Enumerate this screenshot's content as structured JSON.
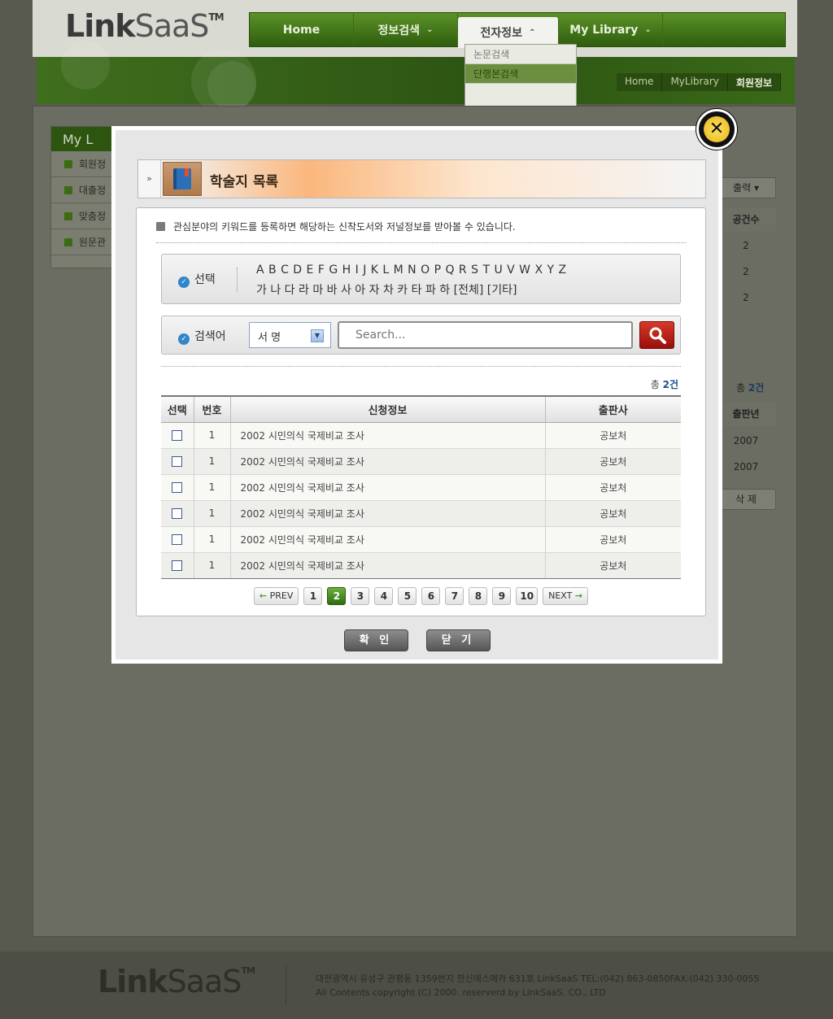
{
  "header": {
    "logo_bold": "Link",
    "logo_light": "SaaS",
    "logo_tm": "TM",
    "nav": [
      "Home",
      "정보검색",
      "전자정보",
      "My Library"
    ],
    "submenu": [
      "논문검색",
      "단행본검색"
    ],
    "breadcrumb": [
      "Home",
      "MyLibrary",
      "회원정보"
    ]
  },
  "background": {
    "left_menu_title": "My L",
    "left_menu_items": [
      "회원정",
      "대출정",
      "맞춤정",
      "원문관"
    ],
    "right_print_label": "출력",
    "right_col_head": "공건수",
    "right_counts": [
      "2",
      "2",
      "2"
    ],
    "right_total_prefix": "총",
    "right_total": "2건",
    "right_col_head2": "출판년",
    "right_years": [
      "2007",
      "2007"
    ],
    "right_delete": "삭 제"
  },
  "modal": {
    "close_symbol": "✕",
    "collapse_symbol": "»",
    "title": "학술지 목록",
    "notice": "관심분야의 키워드를 등록하면 해당하는 신착도서와 저널정보를 받아볼 수 있습니다.",
    "alpha_label": "선택",
    "alpha_row1": "A B C D E F G H I J K L M N O P Q R S T U V W X Y Z",
    "alpha_row2": "가 나 다 라 마 바 사 아 자 차 카 타 파 하   [전체] [기타]",
    "search_label": "검색어",
    "search_select": "서 명",
    "search_placeholder": "Search...",
    "total_prefix": "총",
    "total_value": "2건",
    "columns": [
      "선택",
      "번호",
      "신청정보",
      "출판사"
    ],
    "rows": [
      {
        "no": "1",
        "info": "2002 시민의식 국제비교 조사",
        "publisher": "공보처"
      },
      {
        "no": "1",
        "info": "2002 시민의식 국제비교 조사",
        "publisher": "공보처"
      },
      {
        "no": "1",
        "info": "2002 시민의식 국제비교 조사",
        "publisher": "공보처"
      },
      {
        "no": "1",
        "info": "2002 시민의식 국제비교 조사",
        "publisher": "공보처"
      },
      {
        "no": "1",
        "info": "2002 시민의식 국제비교 조사",
        "publisher": "공보처"
      },
      {
        "no": "1",
        "info": "2002 시민의식 국제비교 조사",
        "publisher": "공보처"
      }
    ],
    "pager": {
      "prev": "PREV",
      "next": "NEXT",
      "pages": [
        "1",
        "2",
        "3",
        "4",
        "5",
        "6",
        "7",
        "8",
        "9",
        "10"
      ],
      "current": "2"
    },
    "confirm": "확 인",
    "close": "닫 기"
  },
  "footer": {
    "logo_bold": "Link",
    "logo_light": "SaaS",
    "logo_tm": "TM",
    "address": "대전광역시 유성구 관평동 1359번지 한신에스메카 631호 LinkSaaS TEL:(042) 863-0850FAX:(042) 330-0055",
    "copyright": "All Contents copyright (C) 2000. reserverd by LinkSaaS. CO., LTD"
  },
  "colors": {
    "accent_green": "#2f6e10",
    "search_red": "#b01a12",
    "overlay": "#595a4f"
  }
}
